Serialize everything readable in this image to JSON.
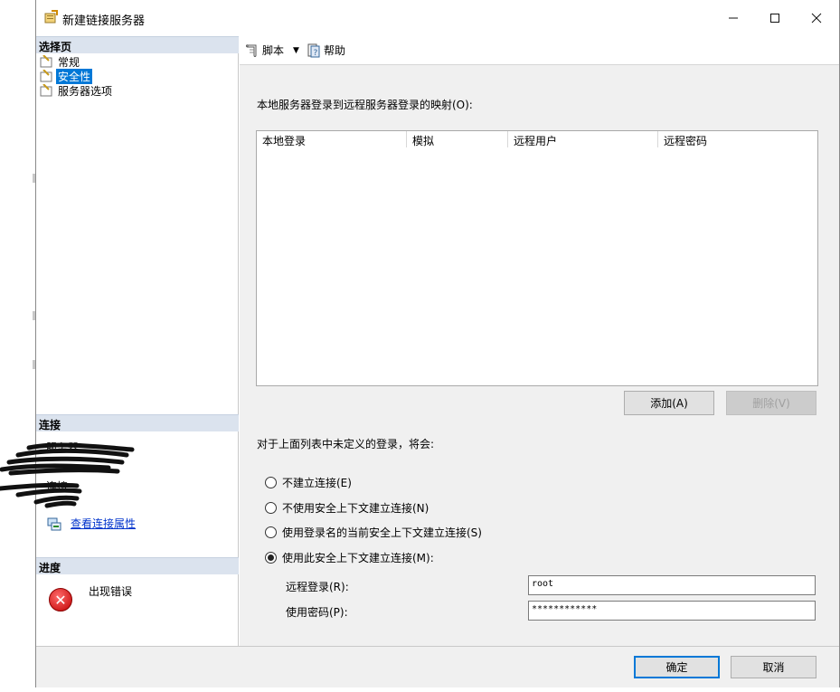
{
  "window": {
    "title": "新建链接服务器"
  },
  "left_pane": {
    "select_page_header": "选择页",
    "pages": [
      {
        "label": "常规"
      },
      {
        "label": "安全性"
      },
      {
        "label": "服务器选项"
      }
    ],
    "connection_header": "连接",
    "server_label": "服务器:",
    "connection_label": "连接:",
    "view_connection_link": "查看连接属性",
    "progress_header": "进度",
    "progress_status": "出现错误"
  },
  "toolbar": {
    "script_label": "脚本",
    "help_label": "帮助"
  },
  "main": {
    "mapping_label": "本地服务器登录到远程服务器登录的映射(O):",
    "columns": [
      "本地登录",
      "模拟",
      "远程用户",
      "远程密码"
    ],
    "add_button": "添加(A)",
    "delete_button": "删除(V)",
    "undefined_login_label": "对于上面列表中未定义的登录，将会:",
    "options": [
      {
        "label": "不建立连接(E)",
        "selected": false
      },
      {
        "label": "不使用安全上下文建立连接(N)",
        "selected": false
      },
      {
        "label": "使用登录名的当前安全上下文建立连接(S)",
        "selected": false
      },
      {
        "label": "使用此安全上下文建立连接(M):",
        "selected": true
      }
    ],
    "remote_login_label": "远程登录(R):",
    "remote_login_value": "root",
    "password_label": "使用密码(P):",
    "password_value": "************"
  },
  "footer": {
    "ok_button": "确定",
    "cancel_button": "取消"
  },
  "colors": {
    "selection": "#0078d7",
    "section_header": "#dbe3ee",
    "link": "#0033cc",
    "error": "#c00000"
  }
}
